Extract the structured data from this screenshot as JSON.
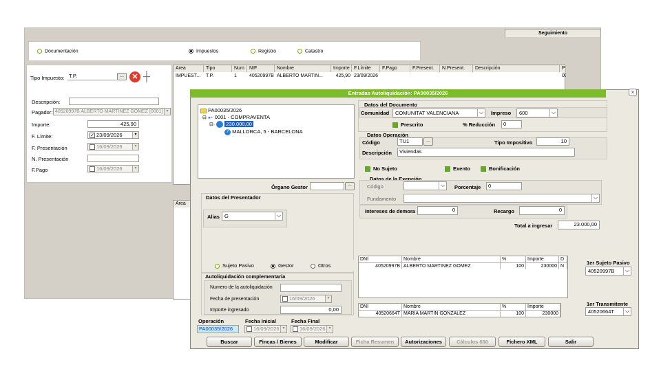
{
  "back": {
    "seguimiento_tab": "Seguimiento",
    "radios": [
      "Documentación",
      "Impuestos",
      "Registro",
      "Catastro"
    ],
    "tipo_impuesto_label": "Tipo Impuesto:",
    "tipo_impuesto_value": "T.P.",
    "descripcion_label": "Descripción:",
    "pagador_label": "Pagador:",
    "pagador_value": "40520997B ALBERTO MARTINEZ GOMEZ [0001]",
    "importe_label": "Importe:",
    "importe_value": "425,90",
    "f_limite_label": "F. Límite:",
    "f_limite_value": "23/09/2026",
    "f_presentacion_label": "F. Presentación",
    "f_presentacion_value": "16/09/2026",
    "n_presentacion_label": "N. Presentación",
    "f_pago_label": "F.Pago",
    "f_pago_value": "16/09/2026",
    "grid_headers": [
      "Area",
      "Tipo",
      "Num",
      "NIF",
      "Nombre",
      "Importe",
      "F.Límite",
      "F.Pago",
      "F.Present.",
      "N.Present.",
      "Descripción",
      "Pr"
    ],
    "grid_row": [
      "IMPUEST...",
      "T.P.",
      "1",
      "40520997B",
      "ALBERTO MARTIN...",
      "425,90",
      "23/09/2026",
      "",
      "",
      "",
      "",
      "00"
    ],
    "grid2_header": "Area"
  },
  "front": {
    "title": "Entradas Autoliquidación: PA00035/2026",
    "close": "×",
    "tree": {
      "root": "PA00035/2026",
      "node1": "0001 - COMPRAVENTA",
      "node2": "230.000,00",
      "node3": "MALLORCA, 5 - BARCELONA"
    },
    "organo_gestor_label": "Órgano Gestor",
    "presentador": {
      "title": "Datos del Presentador",
      "alias_label": "Alias",
      "alias_value": "G",
      "radio_sujeto": "Sujeto Pasivo",
      "radio_gestor": "Gestor",
      "radio_otros": "Otros"
    },
    "complementaria": {
      "title": "Autoliquidación complementaria",
      "numero_label": "Numero de la autoliquidación",
      "fecha_label": "Fecha de presentación",
      "fecha_value": "16/09/2026",
      "importe_label": "Importe ingresado",
      "importe_value": "0,00"
    },
    "operacion_label": "Operación",
    "operacion_value": "PA00035/2026",
    "fecha_inicial_label": "Fecha Inicial",
    "fecha_inicial_value": "16/09/2026",
    "fecha_final_label": "Fecha Final",
    "fecha_final_value": "16/09/2026",
    "documento": {
      "title": "Datos del Documento",
      "comunidad_label": "Comunidad",
      "comunidad_value": "COMUNITAT VALENCIANA",
      "impreso_label": "Impreso",
      "impreso_value": "600",
      "prescrito_label": "Prescrito",
      "reduccion_label": "% Reducción",
      "reduccion_value": "0"
    },
    "operacion_sec": {
      "title": "Datos Operación",
      "codigo_label": "Código",
      "codigo_value": "TU1",
      "tipo_impositivo_label": "Tipo Impositivo",
      "tipo_impositivo_value": "10",
      "descripcion_label": "Descripción",
      "descripcion_value": "Viviendas"
    },
    "no_sujeto_label": "No Sujeto",
    "exento_label": "Exento",
    "bonificacion_label": "Bonificación",
    "exencion": {
      "title": "Datos de la Exención",
      "codigo_label": "Código",
      "porcentaje_label": "Porcentaje",
      "porcentaje_value": "0",
      "fundamento_label": "Fundamento"
    },
    "intereses_label": "Intereses de demora",
    "intereses_value": "0",
    "recargo_label": "Recargo",
    "recargo_value": "0",
    "total_label": "Total a ingresar",
    "total_value": "23.000,00",
    "table_headers": [
      "DNI",
      "Nombre",
      "%",
      "Importe",
      "D"
    ],
    "sujeto_row": [
      "40520997B",
      "ALBERTO MARTINEZ GOMEZ",
      "100",
      "230000",
      "N"
    ],
    "transmitente_headers": [
      "DNI",
      "Nombre",
      "%",
      "Importe"
    ],
    "transmitente_row": [
      "40520664T",
      "MARIA MARTIN GONZALEZ",
      "100",
      "230000"
    ],
    "primer_sujeto_label": "1er Sujeto Pasivo",
    "primer_sujeto_value": "40520997B",
    "primer_transmitente_label": "1er Transmitente",
    "primer_transmitente_value": "40520664T",
    "buttons": [
      "Buscar",
      "Fincas / Bienes",
      "Modificar",
      "Ficha Resumen",
      "Autorizaciones",
      "Cálculos 650",
      "Fichero XML",
      "Salir"
    ]
  }
}
